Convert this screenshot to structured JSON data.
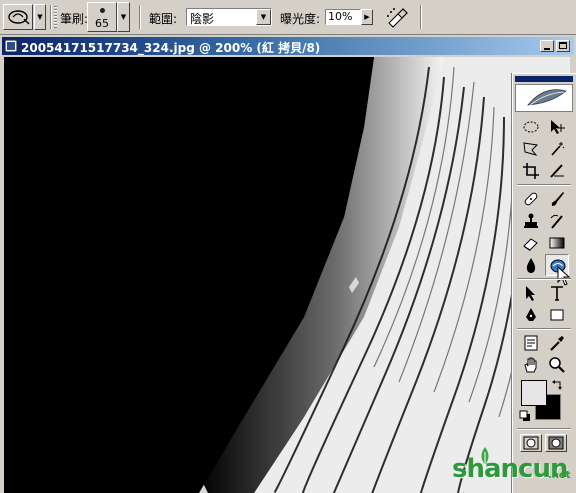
{
  "options_bar": {
    "brush_label": "筆刷:",
    "brush_size": "65",
    "range_label": "範圍:",
    "range_value": "陰影",
    "exposure_label": "曝光度:",
    "exposure_value": "10%",
    "icons": [
      "tool-preset-dodge-icon",
      "airbrush-icon"
    ]
  },
  "document": {
    "title": "20054171517734_324.jpg @ 200% (紅 拷貝/8)"
  },
  "toolbox": {
    "active_tool": "dodge-tool",
    "tools": [
      "marquee",
      "move",
      "lasso",
      "magic-wand",
      "crop",
      "slice",
      "healing-brush",
      "brush",
      "clone-stamp",
      "history-brush",
      "eraser",
      "gradient",
      "blur",
      "dodge",
      "path-selection",
      "type",
      "pen",
      "rectangle",
      "notes",
      "eyedropper",
      "hand",
      "zoom"
    ],
    "foreground_color": "#e6e6e6",
    "background_color": "#000000"
  },
  "watermark": {
    "text": "shancun",
    "sub": ".net"
  },
  "colors": {
    "face": "#d4d0c8",
    "title_start": "#0a246a",
    "title_end": "#a6caf0",
    "watermark": "#2f9a3c"
  }
}
